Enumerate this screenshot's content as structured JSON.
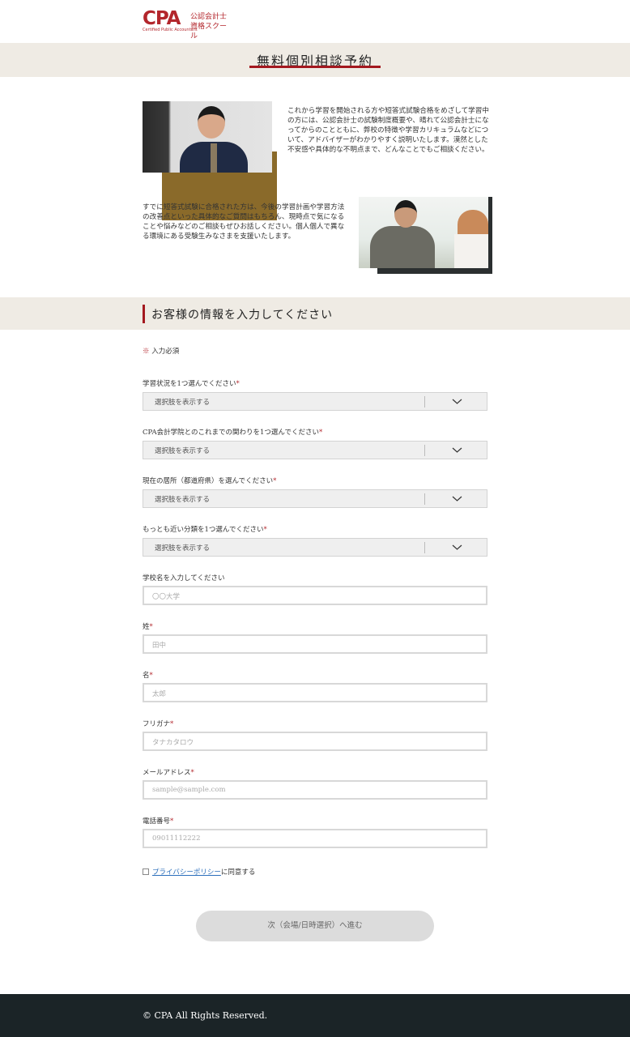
{
  "header": {
    "logo_mark": "CPA",
    "logo_sub": "Certified Public Accountant",
    "logo_line1": "公認会計士",
    "logo_line2": "資格スクール"
  },
  "page_title": "無料個別相談予約",
  "intro": {
    "paragraph1": "これから学習を開始される方や短答式試験合格をめざして学習中の方には、公認会計士の試験制度概要や、晴れて公認会計士になってからのことともに、弊校の特徴や学習カリキュラムなどについて、アドバイザーがわかりやすく説明いたします。漠然とした不安感や具体的な不明点まで、どんなことでもご相談ください。",
    "paragraph2": "すでに短答式試験に合格された方は、今後の学習計画や学習方法の改善点といった具体的なご質問はもちろん、現時点で気になることや悩みなどのご相談もぜひお話しください。個人個人で異なる環境にある受験生みなさまを支援いたします。"
  },
  "section_title": "お客様の情報を入力してください",
  "form": {
    "required_note": "入力必須",
    "required_mark": "※",
    "star": "*",
    "selects": [
      {
        "label": "学習状況を1つ選んでください",
        "value": "選択肢を表示する"
      },
      {
        "label": "CPA会計学院とのこれまでの関わりを1つ選んでください",
        "value": "選択肢を表示する"
      },
      {
        "label": "現在の居所（都道府県）を選んでください",
        "value": "選択肢を表示する"
      },
      {
        "label": "もっとも近い分類を1つ選んでください",
        "value": "選択肢を表示する"
      }
    ],
    "school": {
      "label": "学校名を入力してください",
      "placeholder": "〇〇大学"
    },
    "last_name": {
      "label": "姓",
      "placeholder": "田中"
    },
    "first_name": {
      "label": "名",
      "placeholder": "太郎"
    },
    "furigana": {
      "label": "フリガナ",
      "placeholder": "タナカタロウ"
    },
    "email": {
      "label": "メールアドレス",
      "placeholder": "sample@sample.com"
    },
    "phone": {
      "label": "電話番号",
      "placeholder": "09011112222"
    },
    "agree_link": "プライバシーポリシー",
    "agree_text": "に同意する",
    "submit_label": "次（会場/日時選択）へ進む"
  },
  "footer": {
    "copyright": "© CPA All Rights Reserved."
  },
  "colors": {
    "accent": "#a3181f",
    "band": "#efebe4",
    "footer": "#1b2427"
  }
}
